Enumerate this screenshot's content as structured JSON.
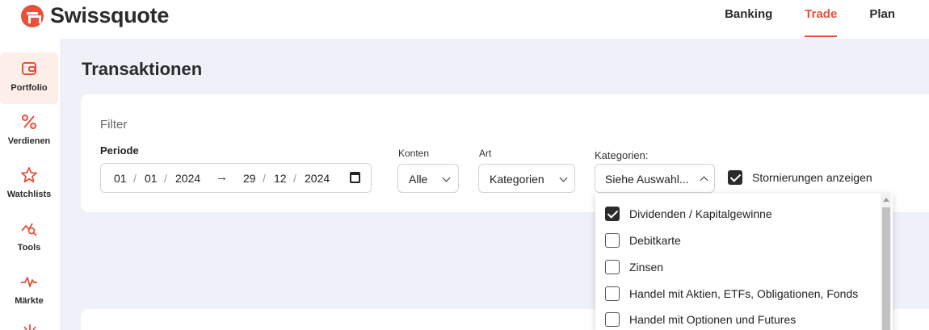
{
  "brand": {
    "name": "Swissquote",
    "color": "#e8503a"
  },
  "topnav": [
    {
      "label": "Banking",
      "active": false
    },
    {
      "label": "Trade",
      "active": true
    },
    {
      "label": "Plan",
      "active": false
    }
  ],
  "sidebar": [
    {
      "label": "Portfolio",
      "icon": "wallet-icon",
      "active": true
    },
    {
      "label": "Verdienen",
      "icon": "percent-icon",
      "active": false
    },
    {
      "label": "Watchlists",
      "icon": "star-icon",
      "active": false
    },
    {
      "label": "Tools",
      "icon": "chart-search-icon",
      "active": false
    },
    {
      "label": "Märkte",
      "icon": "pulse-icon",
      "active": false
    }
  ],
  "page": {
    "title": "Transaktionen"
  },
  "filter": {
    "heading": "Filter",
    "periode_label": "Periode",
    "from": {
      "day": "01",
      "month": "01",
      "year": "2024"
    },
    "to": {
      "day": "29",
      "month": "12",
      "year": "2024"
    },
    "konten": {
      "label": "Konten",
      "value": "Alle"
    },
    "art": {
      "label": "Art",
      "value": "Kategorien"
    },
    "kategorien": {
      "label": "Kategorien:",
      "value": "Siehe Auswahl..."
    },
    "storno": {
      "label": "Stornierungen anzeigen",
      "checked": true
    }
  },
  "kategorien_options": [
    {
      "label": "Dividenden / Kapitalgewinne",
      "checked": true
    },
    {
      "label": "Debitkarte",
      "checked": false
    },
    {
      "label": "Zinsen",
      "checked": false
    },
    {
      "label": "Handel mit Aktien, ETFs, Obligationen, Fonds",
      "checked": false
    },
    {
      "label": "Handel mit Optionen und Futures",
      "checked": false
    }
  ]
}
